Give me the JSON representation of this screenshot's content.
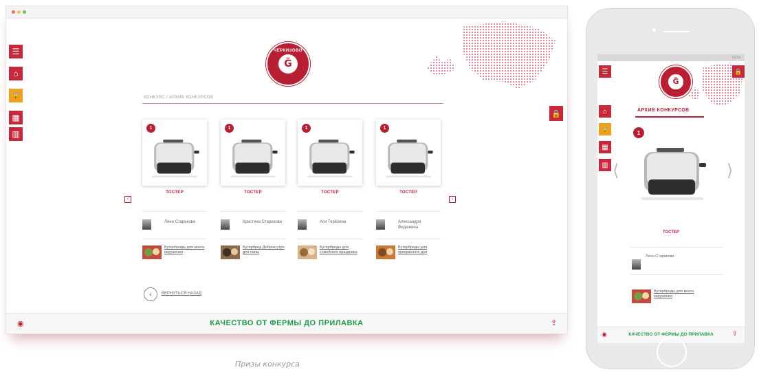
{
  "colors": {
    "brand_red": "#b81f33",
    "accent_orange": "#f0a020",
    "slogan_green": "#1e9b48"
  },
  "desktop": {
    "sidebar": [
      {
        "icon": "menu-icon",
        "glyph": "☰"
      },
      {
        "icon": "home-icon",
        "glyph": "⌂"
      },
      {
        "icon": "lock-icon",
        "glyph": "🔒"
      },
      {
        "icon": "grid-icon",
        "glyph": "▦"
      },
      {
        "icon": "chart-icon",
        "glyph": "▥"
      }
    ],
    "logo": {
      "brand": "ЧЕРКИЗОВО"
    },
    "breadcrumb": "КОНКУРС / АРХИВ КОНКУРСОВ",
    "prizes": [
      {
        "place": "1",
        "name": "ТОСТЕР",
        "winner": "Лена Старикова",
        "recipe": "Бутерброды для моего окружения"
      },
      {
        "place": "1",
        "name": "ТОСТЕР",
        "winner": "Кристина Старикова",
        "recipe": "Бутерброд Доброе утро для папы"
      },
      {
        "place": "1",
        "name": "ТОСТЕР",
        "winner": "Ася Терёхина",
        "recipe": "Бутерброды для семейного праздника"
      },
      {
        "place": "1",
        "name": "ТОСТЕР",
        "winner": "Александра Федюнина",
        "recipe": "Бутерброды для прекрасного дня"
      }
    ],
    "prev_glyph": "‹",
    "next_glyph": "›",
    "back": {
      "glyph": "‹",
      "label": "ВЕРНУТЬСЯ НАЗАД"
    },
    "footer": {
      "slogan": "КАЧЕСТВО ОТ ФЕРМЫ ДО ПРИЛАВКА",
      "left_glyph": "◉",
      "right_glyph": "⇪"
    }
  },
  "caption": "Призы конкурса",
  "phone": {
    "status": "12:53",
    "title": "АРХИВ КОНКУРСОВ",
    "prize": {
      "place": "1",
      "name": "ТОСТЕР",
      "winner": "Лена Старикова",
      "recipe": "Бутерброды для моего окружения"
    },
    "footer": {
      "slogan": "КАЧЕСТВО ОТ ФЕРМЫ ДО ПРИЛАВКА"
    }
  }
}
